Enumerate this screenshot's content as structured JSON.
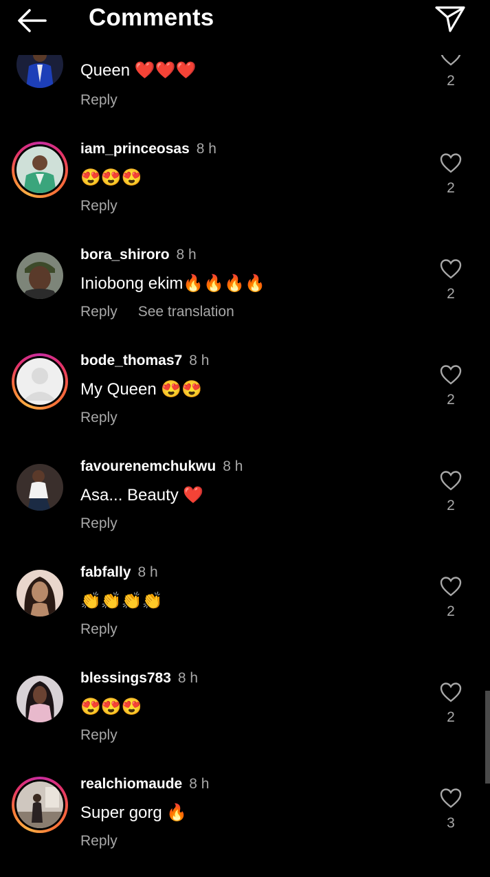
{
  "header": {
    "title": "Comments"
  },
  "comments": [
    {
      "username": "",
      "time": "",
      "text": "Queen ❤️❤️❤️",
      "actions": [
        "Reply"
      ],
      "likes": "2",
      "avatar_ring": false,
      "avatar": "man-blue-suit"
    },
    {
      "username": "iam_princeosas",
      "time": "8 h",
      "text": "😍😍😍",
      "actions": [
        "Reply"
      ],
      "likes": "2",
      "avatar_ring": true,
      "avatar": "man-green-outfit"
    },
    {
      "username": "bora_shiroro",
      "time": "8 h",
      "text": "Iniobong ekim🔥🔥🔥🔥",
      "actions": [
        "Reply",
        "See translation"
      ],
      "likes": "2",
      "avatar_ring": false,
      "avatar": "man-cap"
    },
    {
      "username": "bode_thomas7",
      "time": "8 h",
      "text": "My Queen 😍😍",
      "actions": [
        "Reply"
      ],
      "likes": "2",
      "avatar_ring": true,
      "avatar": "default-person"
    },
    {
      "username": "favourenemchukwu",
      "time": "8 h",
      "text": "Asa... Beauty ❤️",
      "actions": [
        "Reply"
      ],
      "likes": "2",
      "avatar_ring": false,
      "avatar": "woman-white-top"
    },
    {
      "username": "fabfally",
      "time": "8 h",
      "text": "👏👏👏👏",
      "actions": [
        "Reply"
      ],
      "likes": "2",
      "avatar_ring": false,
      "avatar": "woman-long-hair"
    },
    {
      "username": "blessings783",
      "time": "8 h",
      "text": "😍😍😍",
      "actions": [
        "Reply"
      ],
      "likes": "2",
      "avatar_ring": false,
      "avatar": "woman-pink-blazer"
    },
    {
      "username": "realchiomaude",
      "time": "8 h",
      "text": "Super gorg 🔥",
      "actions": [
        "Reply"
      ],
      "likes": "3",
      "avatar_ring": true,
      "avatar": "woman-room"
    }
  ]
}
